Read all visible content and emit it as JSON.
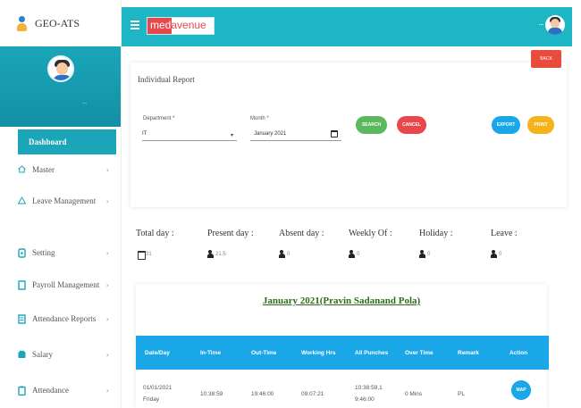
{
  "brand": {
    "name": "GEO-ATS"
  },
  "sidebar": {
    "user_name": "...",
    "items": [
      {
        "label": "Dashboard",
        "active": true
      },
      {
        "label": "Master"
      },
      {
        "label": "Leave Management"
      },
      {
        "label": "Setting"
      },
      {
        "label": "Payroll Management"
      },
      {
        "label": "Attendance Reports"
      },
      {
        "label": "Salary"
      },
      {
        "label": "Attendance"
      }
    ]
  },
  "topbar": {
    "logo_left": "med",
    "logo_right": "avenue",
    "user_name": "..."
  },
  "page": {
    "back_label": "BACK",
    "title": "Individual Report",
    "department_label": "Department *",
    "department_value": "IT",
    "month_label": "Month *",
    "month_value": "January 2021",
    "buttons": {
      "search": "SEARCH",
      "cancel": "CANCEL",
      "export": "EXPORT",
      "print": "PRINT"
    }
  },
  "stats": [
    {
      "label": "Total day :",
      "value": "31"
    },
    {
      "label": "Present day :",
      "value": "21.5"
    },
    {
      "label": "Absent day :",
      "value": "0"
    },
    {
      "label": "Weekly Of :",
      "value": "0"
    },
    {
      "label": "Holiday :",
      "value": "0"
    },
    {
      "label": "Leave :",
      "value": "0"
    }
  ],
  "report": {
    "title": "January 2021(Pravin Sadanand Pola)",
    "columns": [
      "Date/Day",
      "In-Time",
      "Out-Time",
      "Working Hrs",
      "All Punches",
      "Over Time",
      "Remark",
      "Action"
    ],
    "rows": [
      {
        "date": "01/01/2021",
        "day": "Friday",
        "in": "10:38:59",
        "out": "19:46:00",
        "hrs": "09:07:21",
        "punch1": "10:38:59,1",
        "punch2": "9:46:00",
        "ot": "0 Mins",
        "remark": "PL",
        "action": "MAP"
      }
    ]
  },
  "colors": {
    "accent": "#1eb5c4",
    "header": "#1aa7e8",
    "title_green": "#2e6b1d",
    "cancel": "#e8474c",
    "search": "#5cb85c",
    "export": "#1aa7e8",
    "print": "#f5b21b"
  }
}
